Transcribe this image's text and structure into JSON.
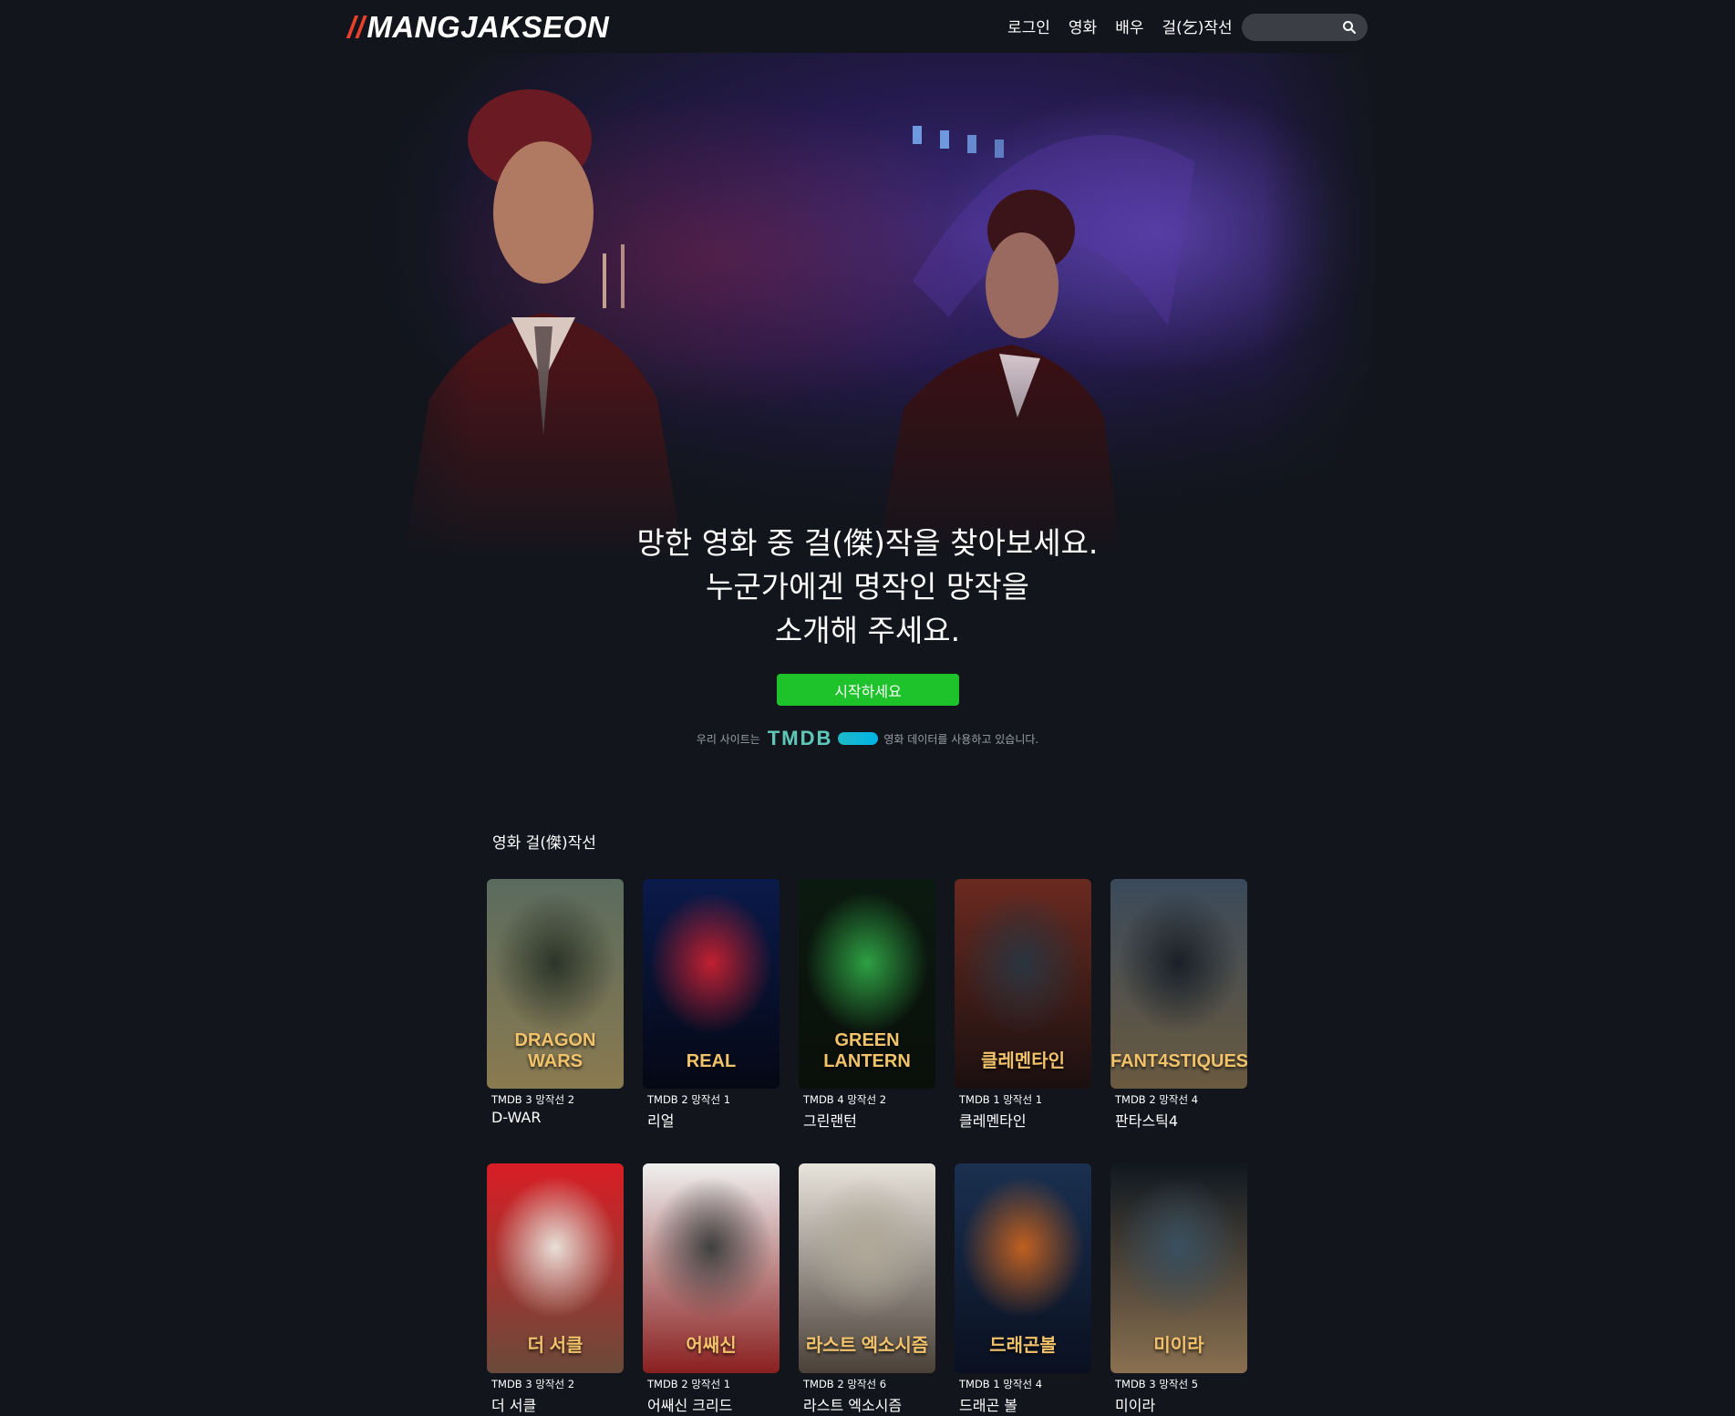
{
  "header": {
    "logo_slash": "//",
    "logo_text": "MANGJAKSEON",
    "nav": [
      "로그인",
      "영화",
      "배우",
      "걸(乞)작선"
    ],
    "search_placeholder": ""
  },
  "hero": {
    "headline": [
      "망한 영화 중 걸(傑)작을 찾아보세요.",
      "누군가에겐 명작인 망작을",
      "소개해 주세요."
    ],
    "cta_label": "시작하세요",
    "credit_prefix": "우리 사이트는",
    "tmdb_logo": "TMDB",
    "credit_suffix": "영화 데이터를 사용하고 있습니다."
  },
  "section": {
    "title": "영화 걸(傑)작선"
  },
  "movies": [
    {
      "meta": "TMDB 3 망작선 2",
      "title": "D-WAR",
      "poster_text": "DRAGON WARS",
      "colors": [
        "#5a6b5e",
        "#2d3529",
        "#8a7a50"
      ]
    },
    {
      "meta": "TMDB 2 망작선 1",
      "title": "리얼",
      "poster_text": "REAL",
      "colors": [
        "#0a1a4a",
        "#c02030",
        "#050814"
      ]
    },
    {
      "meta": "TMDB 4 망작선 2",
      "title": "그린랜턴",
      "poster_text": "GREEN LANTERN",
      "colors": [
        "#0b1a10",
        "#2ea043",
        "#0a0f0a"
      ]
    },
    {
      "meta": "TMDB 1 망작선 1",
      "title": "클레멘타인",
      "poster_text": "클레멘타인",
      "colors": [
        "#6a2a20",
        "#2a3540",
        "#1a1010"
      ]
    },
    {
      "meta": "TMDB 2 망작선 4",
      "title": "판타스틱4",
      "poster_text": "FANT4STIQUES",
      "colors": [
        "#3a4a5a",
        "#1a2028",
        "#6a5a40"
      ]
    },
    {
      "meta": "TMDB 3 망작선 2",
      "title": "더 서클",
      "poster_text": "더 서클",
      "colors": [
        "#d81e25",
        "#e8e0d8",
        "#6a4a3a"
      ]
    },
    {
      "meta": "TMDB 2 망작선 1",
      "title": "어쌔신 크리드",
      "poster_text": "어쌔신",
      "colors": [
        "#f0f0f0",
        "#404040",
        "#8a2020"
      ]
    },
    {
      "meta": "TMDB 2 망작선 6",
      "title": "라스트 엑소시즘",
      "poster_text": "라스트 엑소시즘",
      "colors": [
        "#e8e4dc",
        "#b0a898",
        "#4a4038"
      ]
    },
    {
      "meta": "TMDB 1 망작선 4",
      "title": "드래곤 볼",
      "poster_text": "드래곤볼",
      "colors": [
        "#1a3050",
        "#c06020",
        "#0a1020"
      ]
    },
    {
      "meta": "TMDB 3 망작선 5",
      "title": "미이라",
      "poster_text": "미이라",
      "colors": [
        "#101820",
        "#3a5060",
        "#8a7050"
      ]
    }
  ]
}
